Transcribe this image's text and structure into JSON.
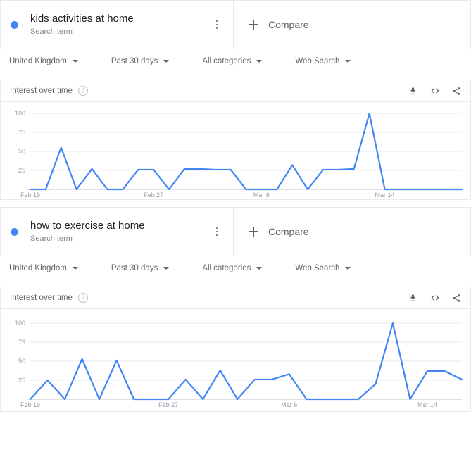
{
  "panels": [
    {
      "term": {
        "title": "kids activities at home",
        "subtitle": "Search term",
        "dot_color": "#4285f4"
      },
      "compare": {
        "label": "Compare",
        "icon": "plus-icon"
      },
      "filters": [
        {
          "label": "United Kingdom"
        },
        {
          "label": "Past 30 days"
        },
        {
          "label": "All categories"
        },
        {
          "label": "Web Search"
        }
      ],
      "interest": {
        "title": "Interest over time",
        "help": "?",
        "actions": [
          {
            "name": "download-icon"
          },
          {
            "name": "embed-icon"
          },
          {
            "name": "share-icon"
          }
        ]
      }
    },
    {
      "term": {
        "title": "how to exercise at home",
        "subtitle": "Search term",
        "dot_color": "#4285f4"
      },
      "compare": {
        "label": "Compare",
        "icon": "plus-icon"
      },
      "filters": [
        {
          "label": "United Kingdom"
        },
        {
          "label": "Past 30 days"
        },
        {
          "label": "All categories"
        },
        {
          "label": "Web Search"
        }
      ],
      "interest": {
        "title": "Interest over time",
        "help": "?",
        "actions": [
          {
            "name": "download-icon"
          },
          {
            "name": "embed-icon"
          },
          {
            "name": "share-icon"
          }
        ]
      }
    }
  ],
  "chart_data": [
    {
      "type": "line",
      "title": "Interest over time",
      "subtitle": "kids activities at home",
      "xlabel": "",
      "ylabel": "",
      "ylim": [
        0,
        100
      ],
      "yticks": [
        25,
        50,
        75,
        100
      ],
      "grid": true,
      "legend": "none",
      "line_color": "#4285f4",
      "xticks": [
        "Feb 19",
        "Feb 27",
        "Mar 6",
        "Mar 14"
      ],
      "xtick_index": [
        0,
        8,
        15,
        23
      ],
      "x": [
        "Feb 19",
        "Feb 20",
        "Feb 21",
        "Feb 22",
        "Feb 23",
        "Feb 24",
        "Feb 25",
        "Feb 26",
        "Feb 27",
        "Feb 28",
        "Feb 29",
        "Mar 1",
        "Mar 2",
        "Mar 3",
        "Mar 4",
        "Mar 5",
        "Mar 6",
        "Mar 7",
        "Mar 8",
        "Mar 9",
        "Mar 10",
        "Mar 11",
        "Mar 12",
        "Mar 13",
        "Mar 14",
        "Mar 15",
        "Mar 16",
        "Mar 17",
        "Mar 18"
      ],
      "values": [
        0,
        0,
        55,
        0,
        27,
        0,
        0,
        26,
        26,
        0,
        27,
        27,
        26,
        26,
        0,
        0,
        0,
        32,
        0,
        26,
        26,
        27,
        100,
        0,
        0,
        0,
        0,
        0,
        0
      ],
      "series": [
        {
          "name": "kids activities at home",
          "points": [
            {
              "x": 0,
              "y": 0
            },
            {
              "x": 0.27,
              "y": 0
            },
            {
              "x": 0.36,
              "y": 55
            },
            {
              "x": 0.47,
              "y": 0
            },
            {
              "x": 0.55,
              "y": 27
            },
            {
              "x": 0.64,
              "y": 0
            },
            {
              "x": 0.76,
              "y": 0
            },
            {
              "x": 0.84,
              "y": 26
            },
            {
              "x": 1.0,
              "y": 26
            }
          ]
        }
      ]
    },
    {
      "type": "line",
      "title": "Interest over time",
      "subtitle": "how to exercise at home",
      "xlabel": "",
      "ylabel": "",
      "ylim": [
        0,
        100
      ],
      "yticks": [
        25,
        50,
        75,
        100
      ],
      "grid": true,
      "legend": "none",
      "line_color": "#4285f4",
      "xticks": [
        "Feb 19",
        "Feb 27",
        "Mar 6",
        "Mar 14"
      ],
      "xtick_index": [
        0,
        8,
        15,
        23
      ],
      "x": [
        "Feb 19",
        "Feb 20",
        "Feb 21",
        "Feb 22",
        "Feb 23",
        "Feb 24",
        "Feb 25",
        "Feb 26",
        "Feb 27",
        "Feb 28",
        "Feb 29",
        "Mar 1",
        "Mar 2",
        "Mar 3",
        "Mar 4",
        "Mar 5",
        "Mar 6",
        "Mar 7",
        "Mar 8",
        "Mar 9",
        "Mar 10",
        "Mar 11",
        "Mar 12",
        "Mar 13",
        "Mar 14",
        "Mar 15",
        "Mar 16",
        "Mar 17",
        "Mar 18"
      ],
      "values": [
        0,
        25,
        0,
        53,
        0,
        51,
        0,
        0,
        0,
        26,
        0,
        38,
        0,
        26,
        26,
        33,
        0,
        0,
        0,
        0,
        20,
        100,
        0,
        37,
        37,
        26
      ],
      "series": [
        {
          "name": "how to exercise at home",
          "points": []
        }
      ]
    }
  ]
}
